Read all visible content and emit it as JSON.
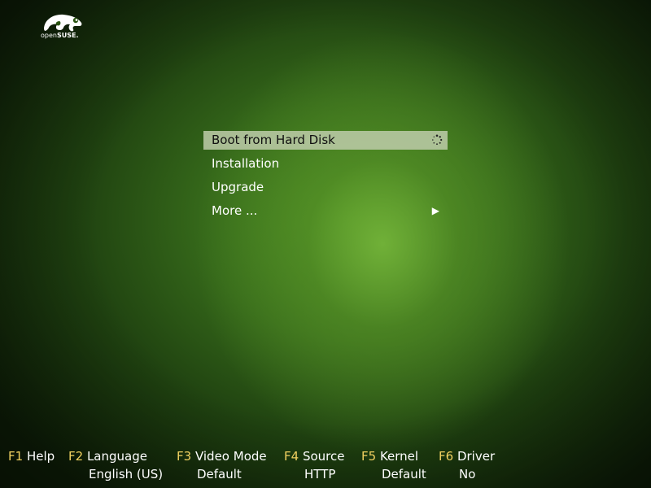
{
  "logo": {
    "icon": "chameleon-icon",
    "text_light": "open",
    "text_bold": "SUSE."
  },
  "menu": {
    "items": [
      {
        "label": "Boot from Hard Disk",
        "selected": true,
        "icon": "spinner-icon"
      },
      {
        "label": "Installation"
      },
      {
        "label": "Upgrade"
      },
      {
        "label": "More ...",
        "icon": "submenu-arrow-icon",
        "arrow": "▶"
      }
    ]
  },
  "footer": {
    "f1": {
      "key": "F1",
      "label": "Help"
    },
    "f2": {
      "key": "F2",
      "label": "Language",
      "value": "English (US)"
    },
    "f3": {
      "key": "F3",
      "label": "Video Mode",
      "value": "Default"
    },
    "f4": {
      "key": "F4",
      "label": "Source",
      "value": "HTTP"
    },
    "f5": {
      "key": "F5",
      "label": "Kernel",
      "value": "Default"
    },
    "f6": {
      "key": "F6",
      "label": "Driver",
      "value": "No"
    }
  },
  "colors": {
    "function_key": "#f0d060",
    "text": "#ffffff",
    "highlight": "#becdaa",
    "background": "#35681a"
  }
}
